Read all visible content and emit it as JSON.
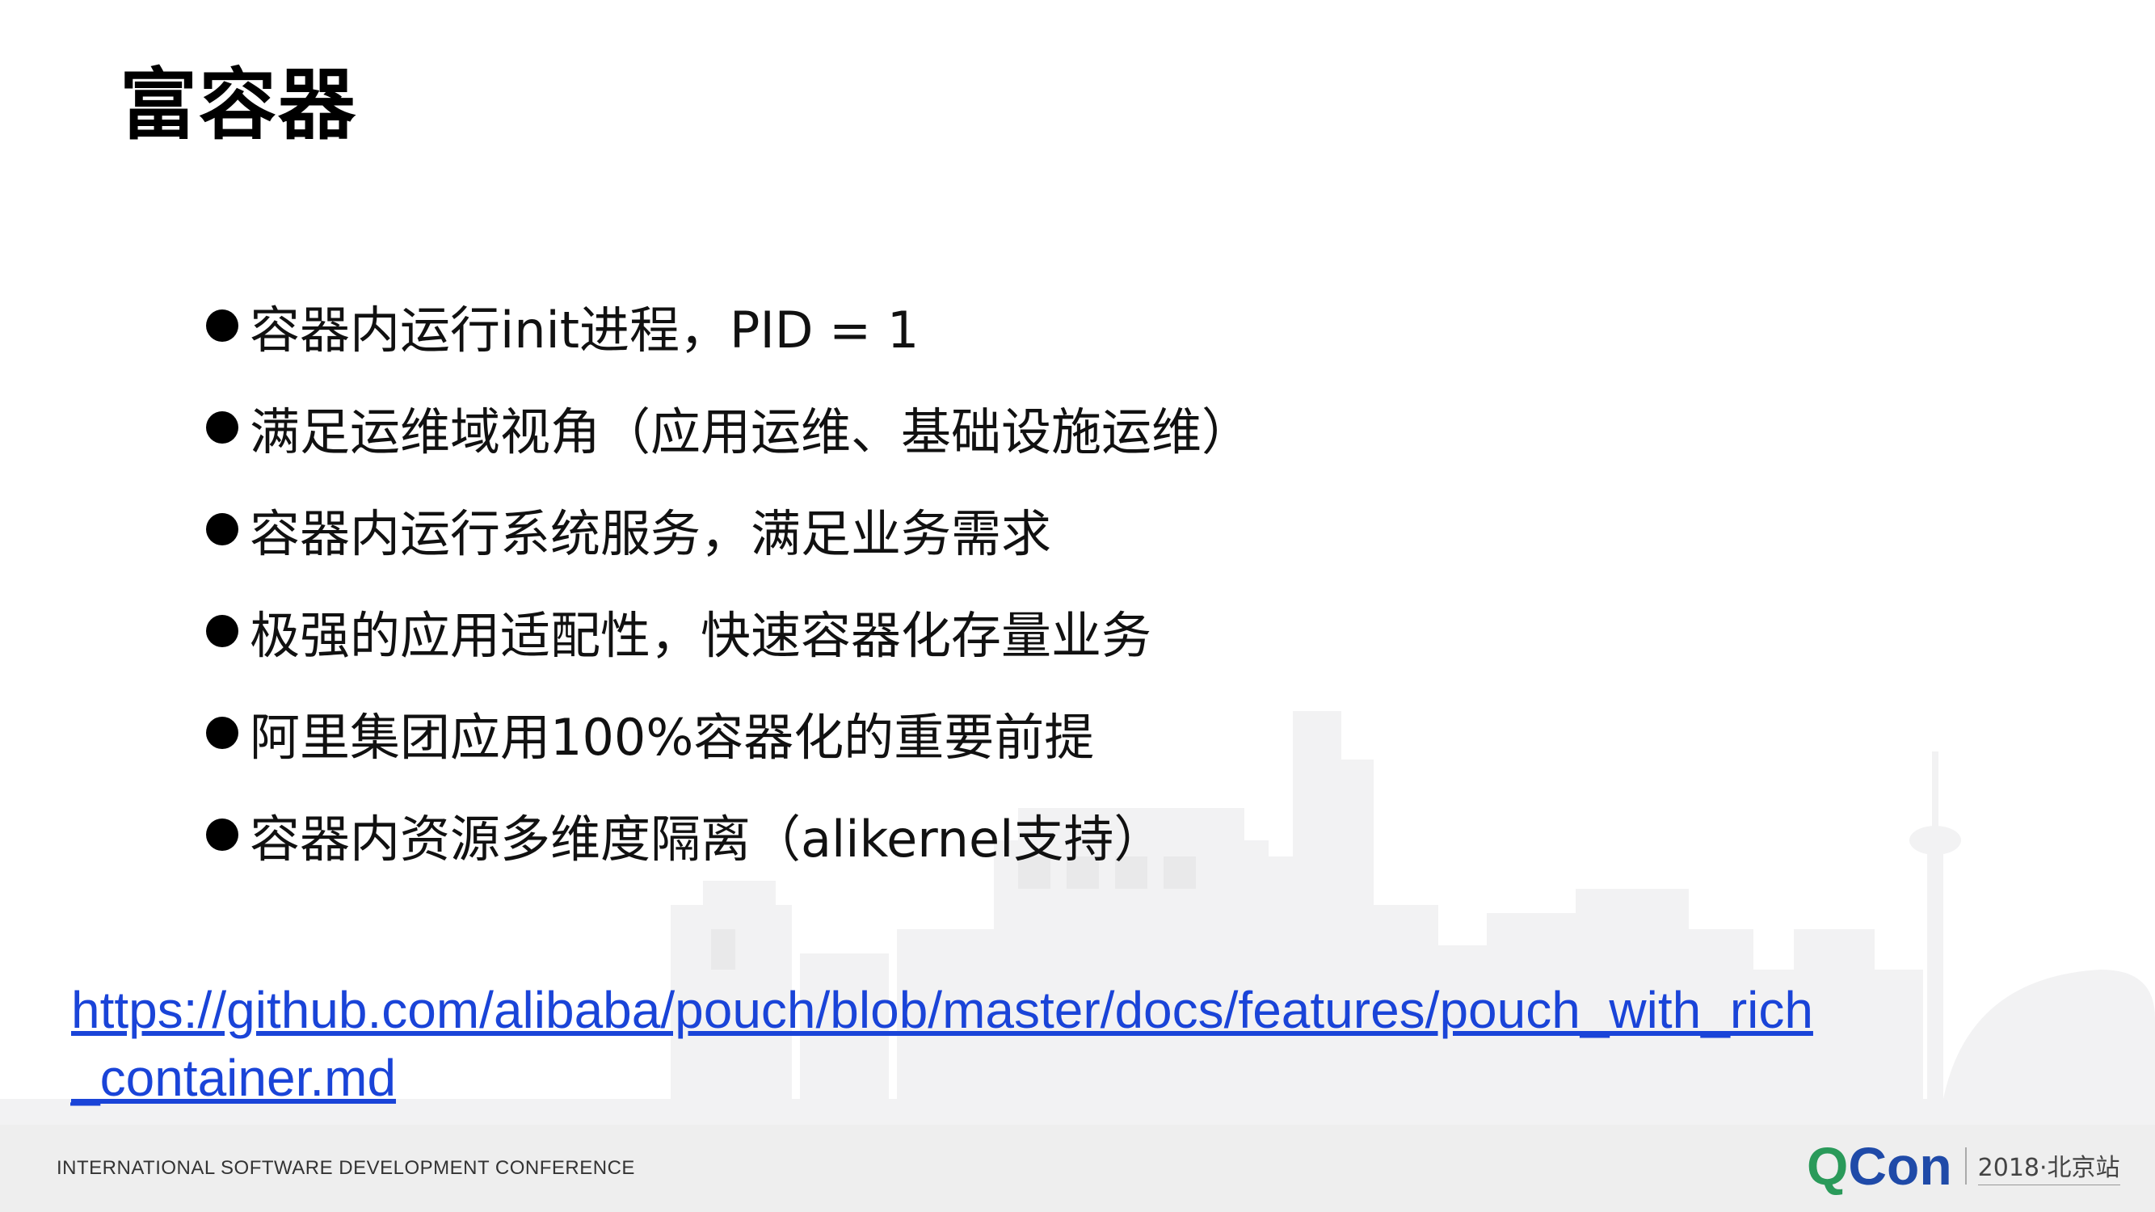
{
  "slide": {
    "title": "富容器",
    "bullets": [
      "容器内运行init进程，PID = 1",
      "满足运维域视角（应用运维、基础设施运维）",
      "容器内运行系统服务，满足业务需求",
      "极强的应用适配性，快速容器化存量业务",
      "阿里集团应用100%容器化的重要前提",
      "容器内资源多维度隔离（alikernel支持）"
    ],
    "link": "https://github.com/alibaba/pouch/blob/master/docs/features/pouch_with_rich_container.md"
  },
  "footer": {
    "conference": "INTERNATIONAL SOFTWARE DEVELOPMENT CONFERENCE",
    "logo_q": "Q",
    "logo_con": "Con",
    "logo_sub": "2018·北京站"
  },
  "colors": {
    "link": "#1a44d8",
    "footer_bg": "#eeeeee",
    "logo_green": "#2a9a5a",
    "logo_blue": "#1f4aa8"
  }
}
